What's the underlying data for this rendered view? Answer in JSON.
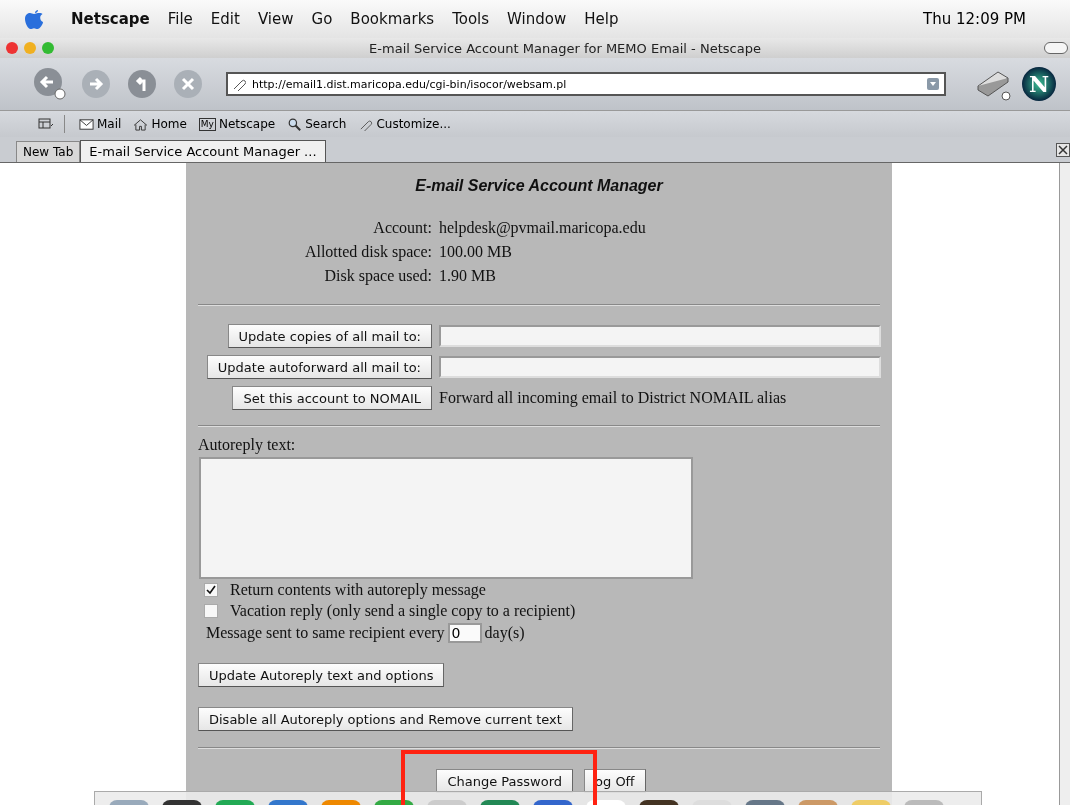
{
  "menu_bar": {
    "app": "Netscape",
    "items": [
      "File",
      "Edit",
      "View",
      "Go",
      "Bookmarks",
      "Tools",
      "Window",
      "Help"
    ],
    "clock": "Thu 12:09 PM"
  },
  "window": {
    "title": "E-mail Service Account Manager for MEMO Email - Netscape"
  },
  "toolbar": {
    "url": "http://email1.dist.maricopa.edu/cgi-bin/isocor/websam.pl",
    "logo": "N"
  },
  "personal_bar": [
    {
      "kind": "mail",
      "label": "Mail"
    },
    {
      "kind": "home",
      "label": "Home"
    },
    {
      "kind": "my",
      "badge": "My",
      "label": "Netscape"
    },
    {
      "kind": "search",
      "label": "Search"
    },
    {
      "kind": "customize",
      "label": "Customize..."
    }
  ],
  "tabs": [
    {
      "label": "New Tab",
      "selected": false
    },
    {
      "label": "E-mail Service Account Manager ...",
      "selected": true
    }
  ],
  "page": {
    "heading": "E-mail Service Account Manager",
    "info": [
      {
        "label": "Account:",
        "value": "helpdesk@pvmail.maricopa.edu"
      },
      {
        "label": "Allotted disk space:",
        "value": "100.00 MB"
      },
      {
        "label": "Disk space used:",
        "value": "1.90 MB"
      }
    ],
    "forward_rows": [
      {
        "kind": "field",
        "button": "Update copies of all mail to:"
      },
      {
        "kind": "field",
        "button": "Update autoforward all mail to:"
      },
      {
        "kind": "note",
        "button": "Set this account to NOMAIL",
        "note": "Forward all incoming email to District NOMAIL alias"
      }
    ],
    "autoreply_label": "Autoreply text:",
    "options": [
      {
        "label": "Return contents with autoreply message",
        "checked": true
      },
      {
        "label": "Vacation reply (only send a single copy to a recipient)",
        "checked": false
      }
    ],
    "interval": {
      "before": "Message sent to same recipient every",
      "value": "0",
      "after": "day(s)"
    },
    "autoreply_buttons": [
      "Update Autoreply text and options",
      "Disable all Autoreply options and Remove current text"
    ],
    "footer_buttons": [
      "Change Password",
      "og Off"
    ]
  }
}
